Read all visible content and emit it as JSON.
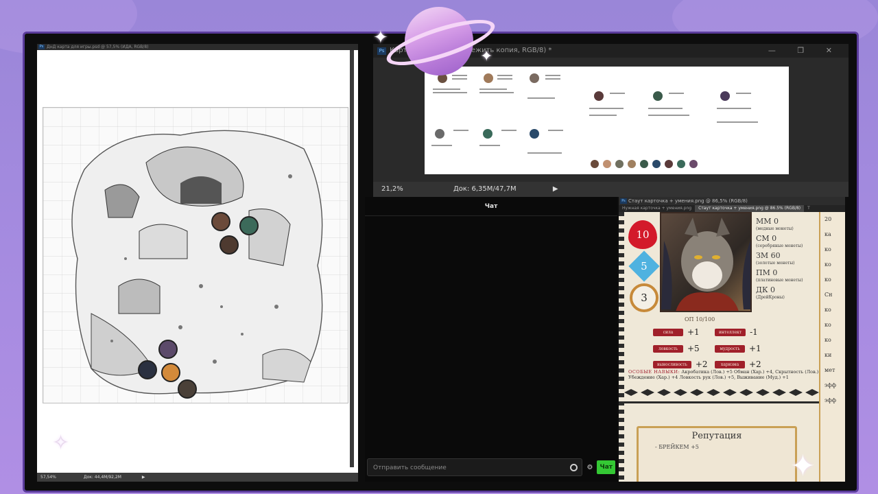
{
  "left_window": {
    "title": "ДнД карта для игры.psd @ 57,5% (ИДА, RGB/8)",
    "zoom": "57,54%",
    "doc_info": "Док: 44,4M/92,2M"
  },
  "top_window": {
    "title": "Карто… % (Рыболюд нежить копия, RGB/8) *",
    "zoom": "21,2%",
    "doc_info": "Док: 6,35M/47,7M",
    "window_controls": [
      "—",
      "❐",
      "✕"
    ]
  },
  "chat": {
    "header": "Чат",
    "placeholder": "Отправить сообщение",
    "send_label": "Чат",
    "accent": "#34c834"
  },
  "sheet_window": {
    "title": "Стаут карточка + умения.png @ 86,5% (RGB/8)",
    "tabs": [
      "Нужная карточка + умения.png",
      "Стаут карточка + умения.png @ 86.5% (RGB/8)",
      "Т"
    ],
    "hp": "10",
    "armor": "5",
    "level": "3",
    "coins": [
      {
        "code": "ММ 0",
        "desc": "(медные монеты)"
      },
      {
        "code": "СМ 0",
        "desc": "(серебряные монеты)"
      },
      {
        "code": "ЗМ 60",
        "desc": "(золотые монеты)"
      },
      {
        "code": "ПМ 0",
        "desc": "(платиновые монеты)"
      },
      {
        "code": "ДК 0",
        "desc": "(ДрейКроны)"
      }
    ],
    "exp": "ОП 10/100",
    "abilities": [
      {
        "tag": "сила",
        "value": "+1"
      },
      {
        "tag": "интеллект",
        "value": "-1"
      },
      {
        "tag": "ловкость",
        "value": "+5"
      },
      {
        "tag": "мудрость",
        "value": "+1"
      },
      {
        "tag": "выносливость",
        "value": "+2"
      },
      {
        "tag": "харизма",
        "value": "+2"
      }
    ],
    "skills_label": "ОСОБЫЕ НАВЫКИ:",
    "skills_text": "Акробатика (Лов.) +5 Обман (Хар.) +4, Скрытность (Лов.) +7, Убеждение (Хар.) +4 Ловкость рук (Лов.) +5, Выживание (Муд.) +1",
    "reputation_title": "Репутация",
    "reputation_line": "- БРЕЙКЕМ +5",
    "right_column": [
      "20",
      "ка",
      "ко",
      "ко",
      "ко",
      "Сн",
      "ко",
      "ко",
      "ко",
      "ки",
      "мет",
      "эфф",
      "эфф"
    ]
  }
}
